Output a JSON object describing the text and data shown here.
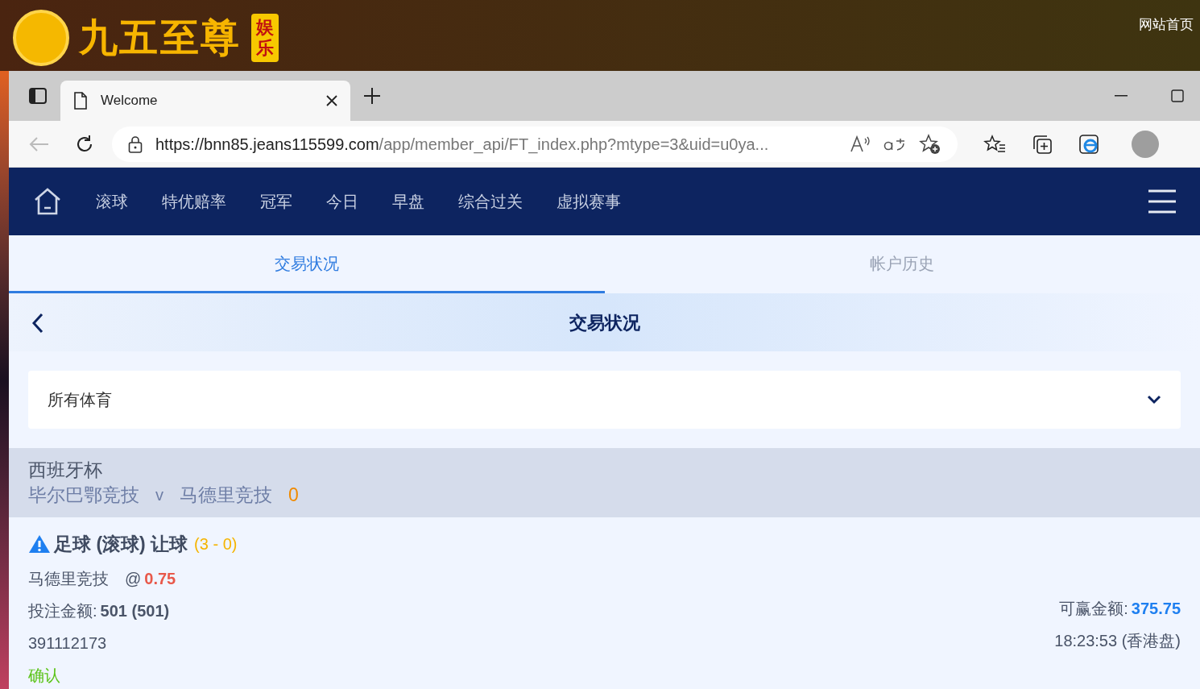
{
  "background_site": {
    "logo_text": "九五至尊",
    "logo_badge": "娱乐",
    "home_link": "网站首页"
  },
  "browser": {
    "tab_title": "Welcome",
    "url_host": "https://bnn85.jeans115599.com",
    "url_rest": "/app/member_api/FT_index.php?mtype=3&uid=u0ya..."
  },
  "nav": {
    "items": [
      "滚球",
      "特优赔率",
      "冠军",
      "今日",
      "早盘",
      "综合过关",
      "虚拟赛事"
    ]
  },
  "tabs": [
    {
      "label": "交易状况",
      "selected": true
    },
    {
      "label": "帐户历史",
      "selected": false
    }
  ],
  "header": {
    "title": "交易状况"
  },
  "filter": {
    "value": "所有体育"
  },
  "match": {
    "league": "西班牙杯",
    "home": "毕尔巴鄂竞技",
    "vs": "v",
    "away": "马德里竞技",
    "score": "0"
  },
  "bet": {
    "title": "足球 (滚球) 让球",
    "score": "(3 - 0)",
    "pick": "马德里竞技",
    "at": "@",
    "odds": "0.75",
    "stake_label": "投注金额:",
    "stake": "501 (501)",
    "win_label": "可赢金额:",
    "win": "375.75",
    "ticket": "391112173",
    "time": "18:23:53 (香港盘)",
    "status": "确认"
  }
}
